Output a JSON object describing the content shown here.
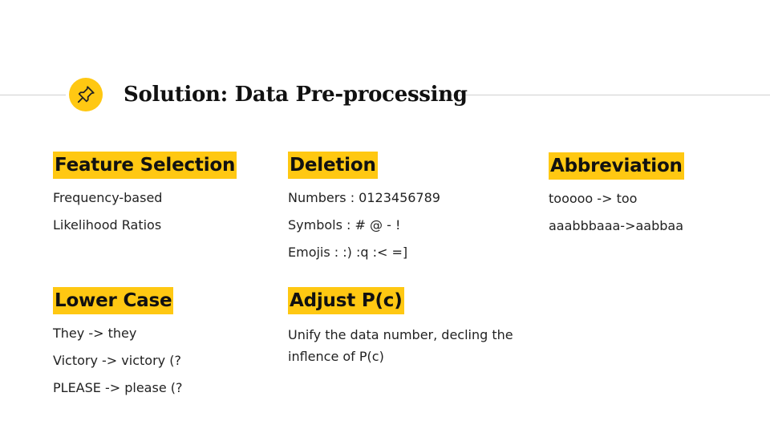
{
  "slide": {
    "title": "Solution: Data Pre-processing",
    "accent": "#ffc812"
  },
  "sections": {
    "feature_selection": {
      "heading": "Feature Selection",
      "items": [
        "Frequency-based",
        "Likelihood Ratios"
      ]
    },
    "deletion": {
      "heading": "Deletion",
      "items": [
        "Numbers : 0123456789",
        "Symbols :  # @ - !",
        "Emojis :  :)  :q  :<  =]"
      ]
    },
    "abbreviation": {
      "heading": "Abbreviation",
      "items": [
        "tooooo -> too",
        "aaabbbaaa->aabbaa"
      ]
    },
    "lower_case": {
      "heading": "Lower Case",
      "items": [
        "They -> they",
        "Victory -> victory (?",
        "PLEASE -> please (?"
      ]
    },
    "adjust_pc": {
      "heading": "Adjust P(c)",
      "text": "Unify the data number,  decling the inflence of P(c)"
    }
  }
}
